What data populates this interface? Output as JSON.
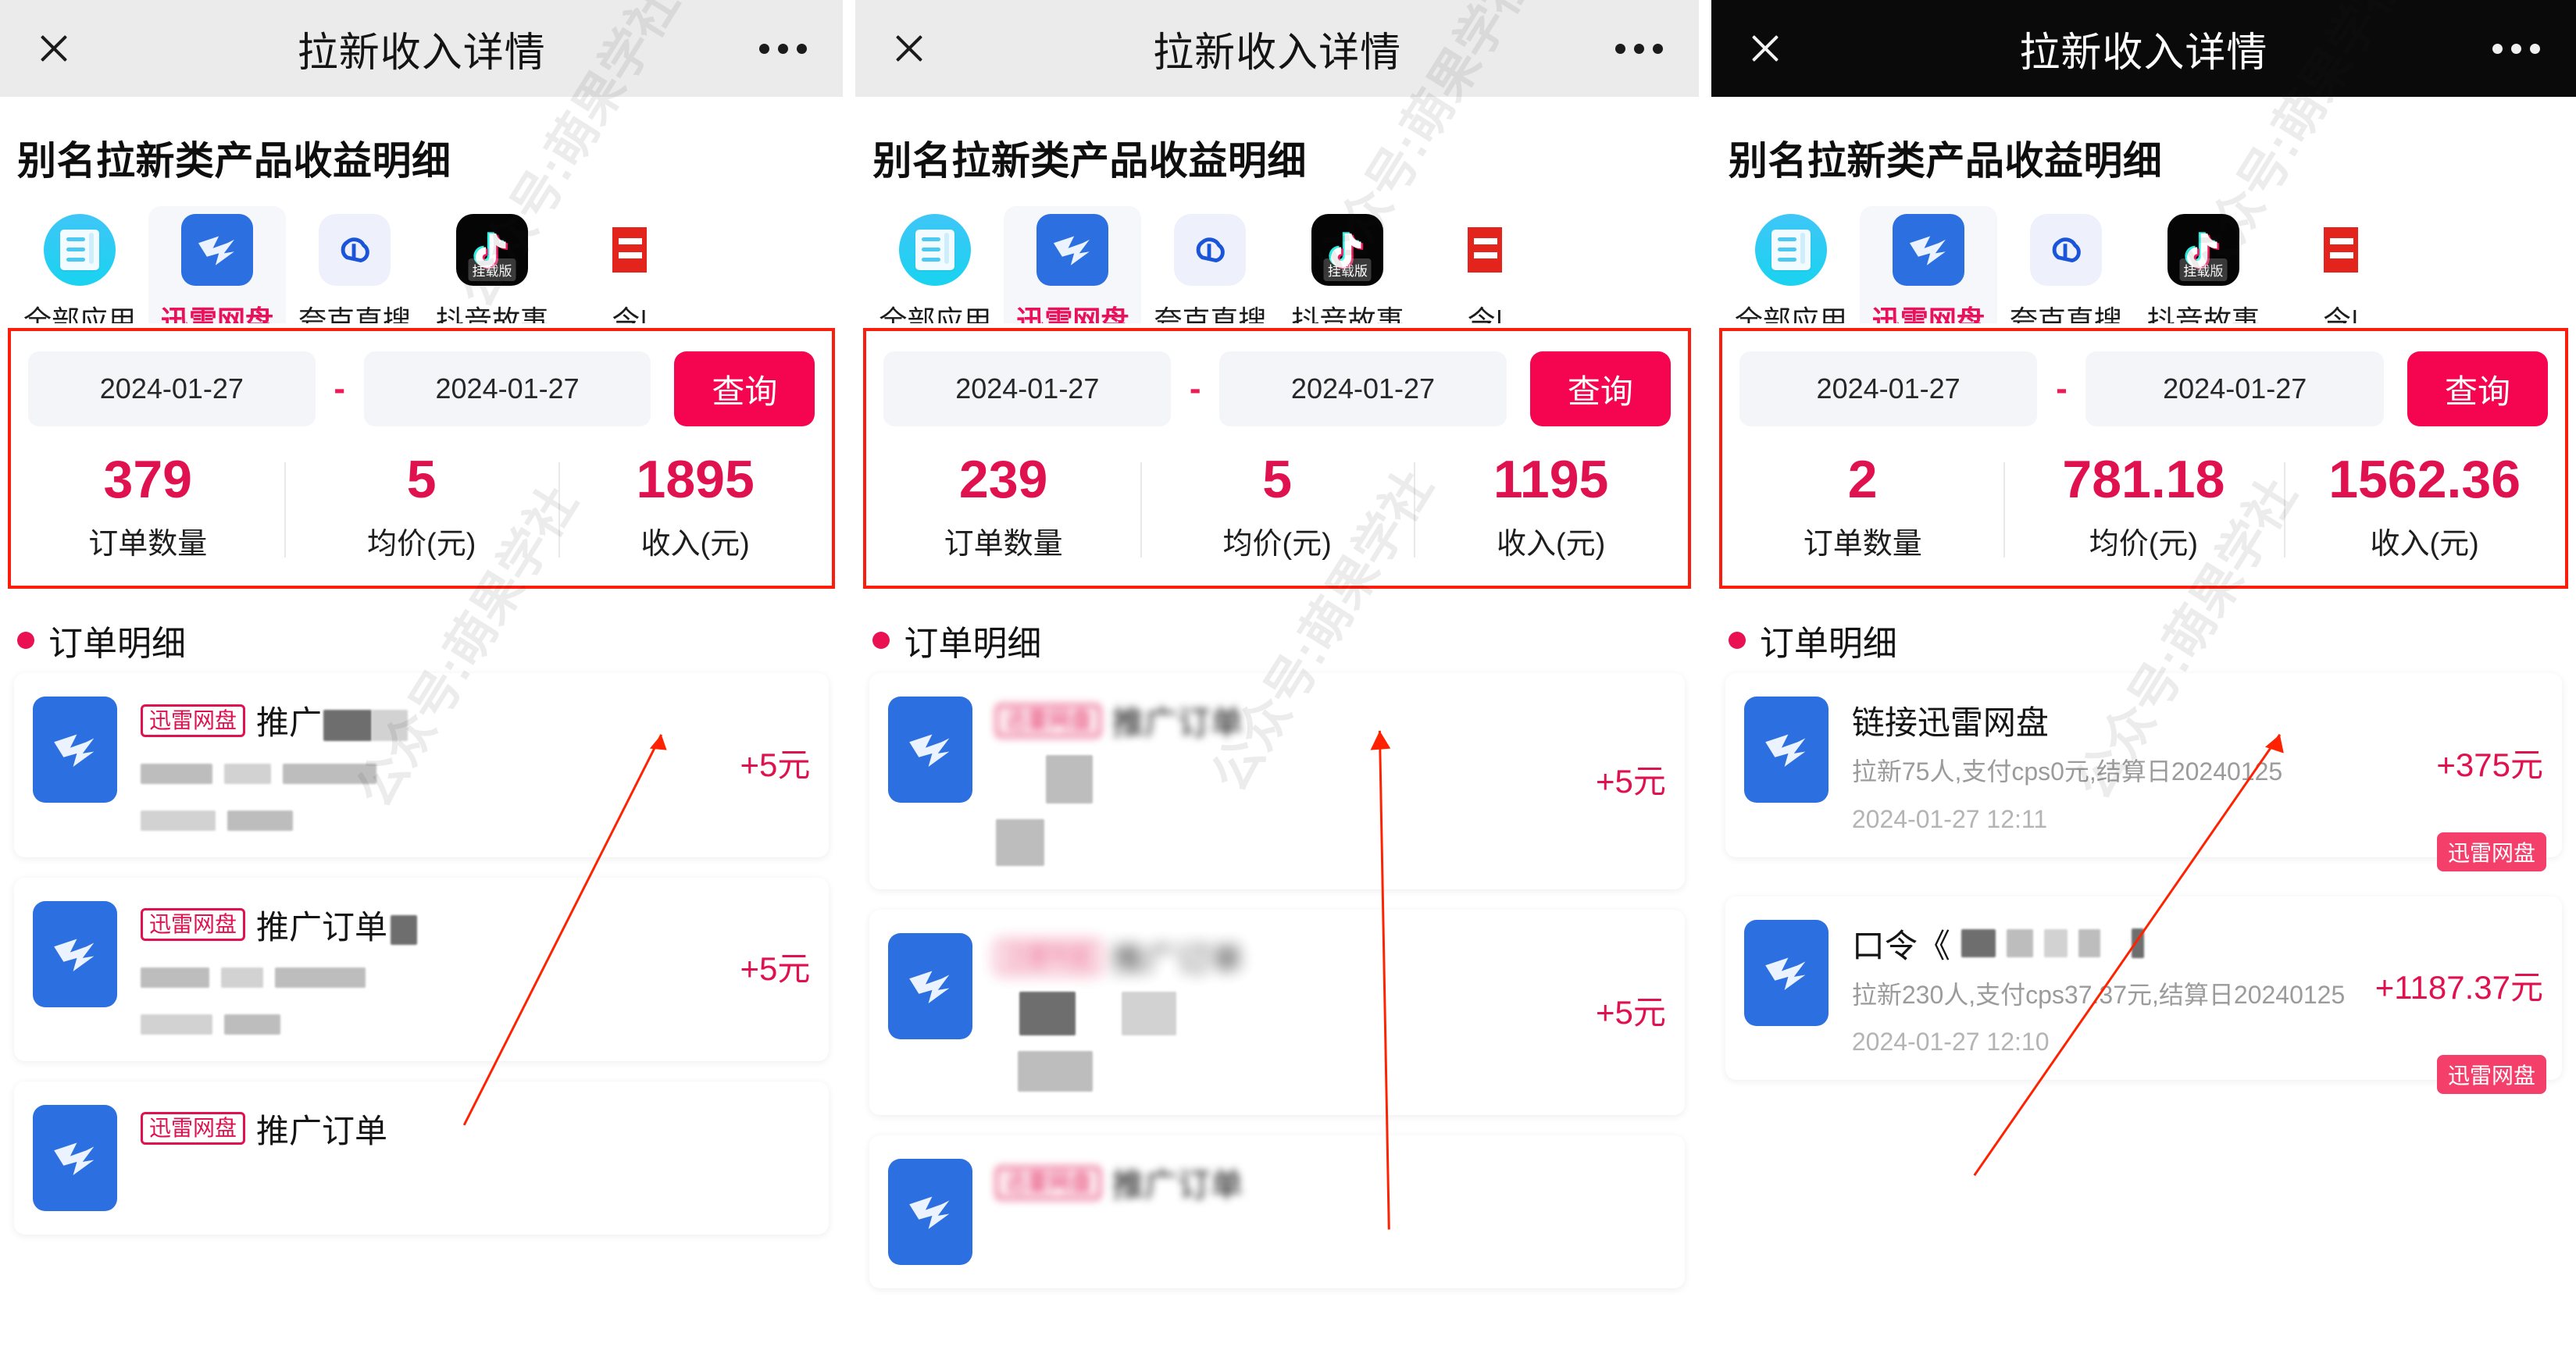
{
  "nav": {
    "title": "拉新收入详情",
    "close_icon": "close-icon",
    "more_icon": "more-dots-icon"
  },
  "page_title": "别名拉新类产品收益明细",
  "app_tabs": [
    {
      "label": "全部应用",
      "icon": "all-apps-icon",
      "active": false
    },
    {
      "label": "迅雷网盘",
      "icon": "xunlei-pan-icon",
      "active": true
    },
    {
      "label": "夸克直搜",
      "icon": "quark-search-icon",
      "active": false
    },
    {
      "label": "抖音故事",
      "icon": "douyin-story-icon",
      "badge": "挂载版",
      "active": false
    },
    {
      "label": "今|",
      "icon": "toutiao-icon",
      "active": false
    }
  ],
  "filter": {
    "start_date": "2024-01-27",
    "end_date": "2024-01-27",
    "separator": "-",
    "query_label": "查询"
  },
  "stat_labels": {
    "orders": "订单数量",
    "avg_price": "均价(元)",
    "income": "收入(元)"
  },
  "section": {
    "orders_title": "订单明细"
  },
  "watermark": "公众号:萌果学社",
  "colors": {
    "accent_pink": "#e0114f",
    "query_button": "#f5054f",
    "highlight_box": "#fc1d0c",
    "brand_blue": "#2c6fe0",
    "chip_pink": "#f43f6b"
  },
  "panels": [
    {
      "id": "panel-1",
      "header_theme": "light",
      "stats": {
        "orders": "379",
        "avg_price": "5",
        "income": "1895"
      },
      "orders": [
        {
          "tag": "迅雷网盘",
          "title": "推广订单",
          "title_redacted": true,
          "sub": "",
          "sub_redacted": true,
          "time": "",
          "time_redacted": true,
          "amount": "+5元",
          "chip": ""
        },
        {
          "tag": "迅雷网盘",
          "title": "推广订单",
          "title_redacted": true,
          "sub": "",
          "sub_redacted": true,
          "time": "",
          "time_redacted": true,
          "amount": "+5元",
          "chip": ""
        },
        {
          "tag": "迅雷网盘",
          "title": "推广订单",
          "title_redacted": true,
          "sub": "",
          "sub_redacted": true,
          "time": "",
          "time_redacted": true,
          "amount": "",
          "chip": ""
        }
      ]
    },
    {
      "id": "panel-2",
      "header_theme": "light",
      "stats": {
        "orders": "239",
        "avg_price": "5",
        "income": "1195"
      },
      "orders": [
        {
          "tag": "迅雷网盘",
          "title": "推广订单",
          "title_redacted": true,
          "sub": "",
          "sub_redacted": true,
          "time": "",
          "time_redacted": true,
          "amount": "+5元",
          "chip": ""
        },
        {
          "tag": "迅雷网盘",
          "title": "推广订单",
          "title_redacted": true,
          "sub": "",
          "sub_redacted": true,
          "time": "",
          "time_redacted": true,
          "amount": "+5元",
          "chip": ""
        },
        {
          "tag": "迅雷网盘",
          "title": "推广订单",
          "title_redacted": true,
          "sub": "",
          "sub_redacted": true,
          "time": "",
          "time_redacted": true,
          "amount": "",
          "chip": ""
        }
      ]
    },
    {
      "id": "panel-3",
      "header_theme": "dark",
      "stats": {
        "orders": "2",
        "avg_price": "781.18",
        "income": "1562.36"
      },
      "orders": [
        {
          "tag": "",
          "title": "链接迅雷网盘",
          "title_redacted": false,
          "sub": "拉新75人,支付cps0元,结算日20240125",
          "sub_redacted": false,
          "time": "2024-01-27 12:11",
          "time_redacted": false,
          "amount": "+375元",
          "chip": "迅雷网盘"
        },
        {
          "tag": "",
          "title": "口令《",
          "title_redacted": true,
          "sub": "拉新230人,支付cps37.37元,结算日20240125",
          "sub_redacted": false,
          "time": "2024-01-27 12:10",
          "time_redacted": false,
          "amount": "+1187.37元",
          "chip": "迅雷网盘"
        }
      ]
    }
  ]
}
